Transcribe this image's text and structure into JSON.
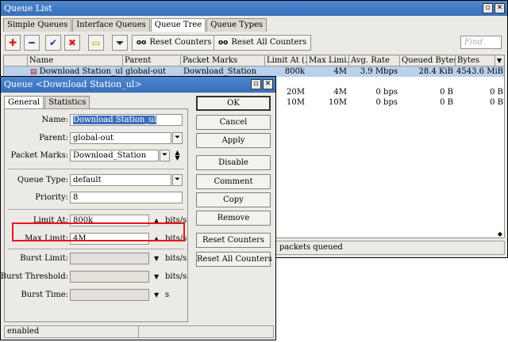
{
  "queue_list": {
    "title": "Queue List",
    "tabs": [
      "Simple Queues",
      "Interface Queues",
      "Queue Tree",
      "Queue Types"
    ],
    "active_tab": "Queue Tree",
    "toolbar": {
      "icons": [
        "add-icon",
        "remove-icon",
        "enable-icon",
        "disable-icon",
        "comment-icon",
        "filter-icon"
      ],
      "reset_counters": "Reset Counters",
      "reset_all_counters": "Reset All Counters",
      "find_placeholder": "Find"
    },
    "columns": [
      "Name",
      "Parent",
      "Packet Marks",
      "Limit At (...",
      "Max Limi...",
      "Avg. Rate",
      "Queued Bytes",
      "Bytes"
    ],
    "rows": [
      {
        "name": "Download Station_ul",
        "parent": "global-out",
        "packet_marks": "Download_Station",
        "limit_at": "800k",
        "max_limit": "4M",
        "avg_rate": "3.9 Mbps",
        "queued_bytes": "28.4 KiB",
        "bytes": "4543.6 MiB"
      },
      {
        "limit_at": "20M",
        "max_limit": "4M",
        "avg_rate": "0 bps",
        "queued_bytes": "0 B",
        "bytes": "0 B"
      },
      {
        "limit_at": "10M",
        "max_limit": "10M",
        "avg_rate": "0 bps",
        "queued_bytes": "0 B",
        "bytes": "0 B"
      }
    ],
    "status": "packets queued"
  },
  "queue_dialog": {
    "title": "Queue <Download Station_ul>",
    "tabs": [
      "General",
      "Statistics"
    ],
    "active_tab": "General",
    "fields": {
      "name_label": "Name:",
      "name_value": "Download Station_ul",
      "parent_label": "Parent:",
      "parent_value": "global-out",
      "packet_marks_label": "Packet Marks:",
      "packet_marks_value": "Download_Station",
      "queue_type_label": "Queue Type:",
      "queue_type_value": "default",
      "priority_label": "Priority:",
      "priority_value": "8",
      "limit_at_label": "Limit At:",
      "limit_at_value": "800k",
      "max_limit_label": "Max Limit:",
      "max_limit_value": "4M",
      "burst_limit_label": "Burst Limit:",
      "burst_limit_value": "",
      "burst_threshold_label": "Burst Threshold:",
      "burst_threshold_value": "",
      "burst_time_label": "Burst Time:",
      "burst_time_value": "",
      "unit_bits": "bits/s",
      "unit_s": "s"
    },
    "buttons": [
      "OK",
      "Cancel",
      "Apply",
      "Disable",
      "Comment",
      "Copy",
      "Remove",
      "Reset Counters",
      "Reset All Counters"
    ],
    "status": "enabled",
    "highlight_color": "#e8141c"
  }
}
